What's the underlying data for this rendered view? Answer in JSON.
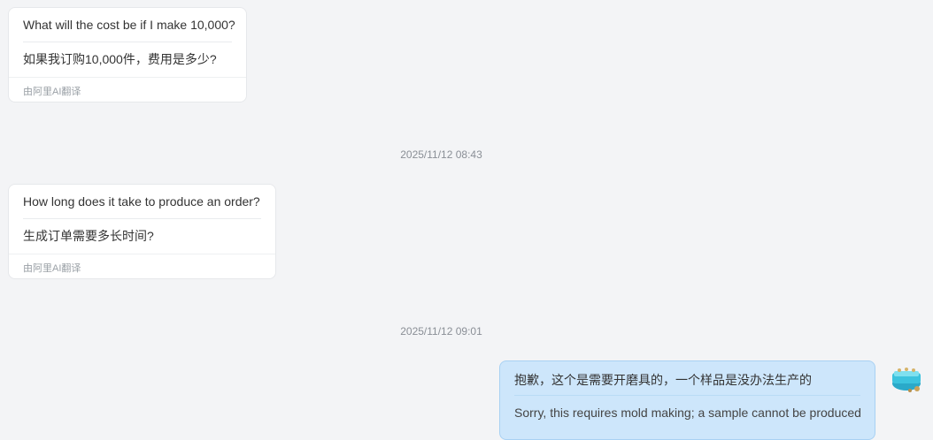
{
  "messages": [
    {
      "original": "What will the cost be if I make 10,000?",
      "translation": "如果我订购10,000件，费用是多少?",
      "footer": "由阿里AI翻译"
    },
    {
      "original": "How long does it take to produce an order?",
      "translation": "生成订单需要多长时间?",
      "footer": "由阿里AI翻译"
    },
    {
      "original": "抱歉，这个是需要开磨具的，一个样品是没办法生产的",
      "translation": "Sorry, this requires mold making; a sample cannot be produced"
    }
  ],
  "timestamps": [
    "2025/11/12 08:43",
    "2025/11/12 09:01"
  ],
  "colors": {
    "background": "#f3f4f6",
    "incoming_bubble": "#ffffff",
    "outgoing_bubble": "#cde6fb",
    "outgoing_border": "#a8d1f3"
  },
  "avatar": {
    "icon": "product-thumbnail-icon"
  }
}
